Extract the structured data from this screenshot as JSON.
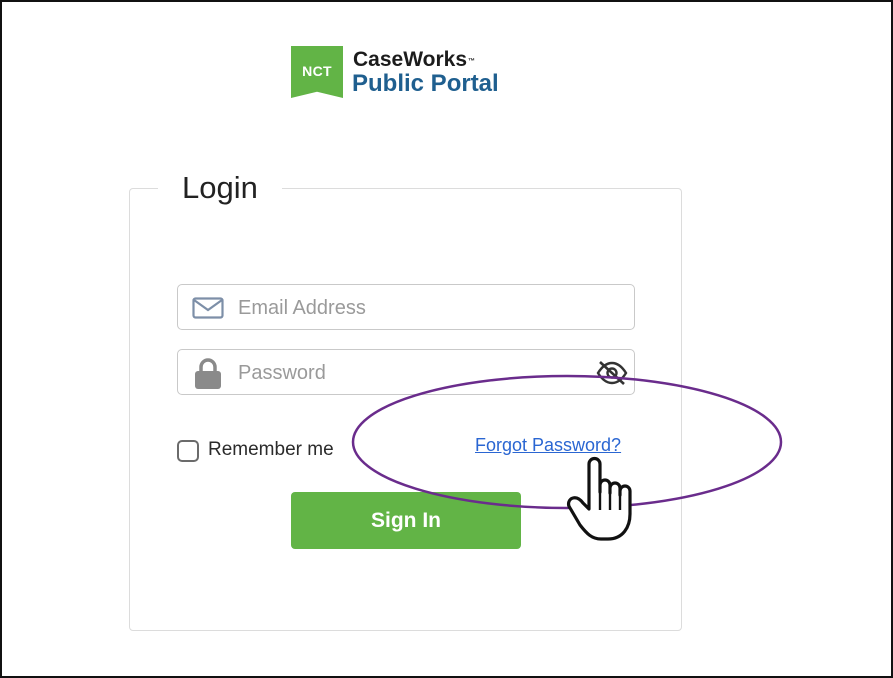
{
  "logo": {
    "badge_text": "NCT",
    "title": "CaseWorks",
    "trademark": "™",
    "subtitle": "Public Portal",
    "badge_color": "#62b446",
    "subtitle_color": "#1f5f8f"
  },
  "login": {
    "legend": "Login",
    "email": {
      "placeholder": "Email Address",
      "value": "",
      "icon": "mail-icon"
    },
    "password": {
      "placeholder": "Password",
      "value": "",
      "icon": "lock-icon",
      "toggle_icon": "eye-off-icon"
    },
    "remember_label": "Remember me",
    "remember_checked": false,
    "forgot_link": "Forgot Password?",
    "signin_label": "Sign In",
    "signin_color": "#62b446",
    "link_color": "#2a66d2"
  },
  "annotation": {
    "highlight_color": "#6a2c8c",
    "cursor_icon": "hand-pointer-icon"
  }
}
